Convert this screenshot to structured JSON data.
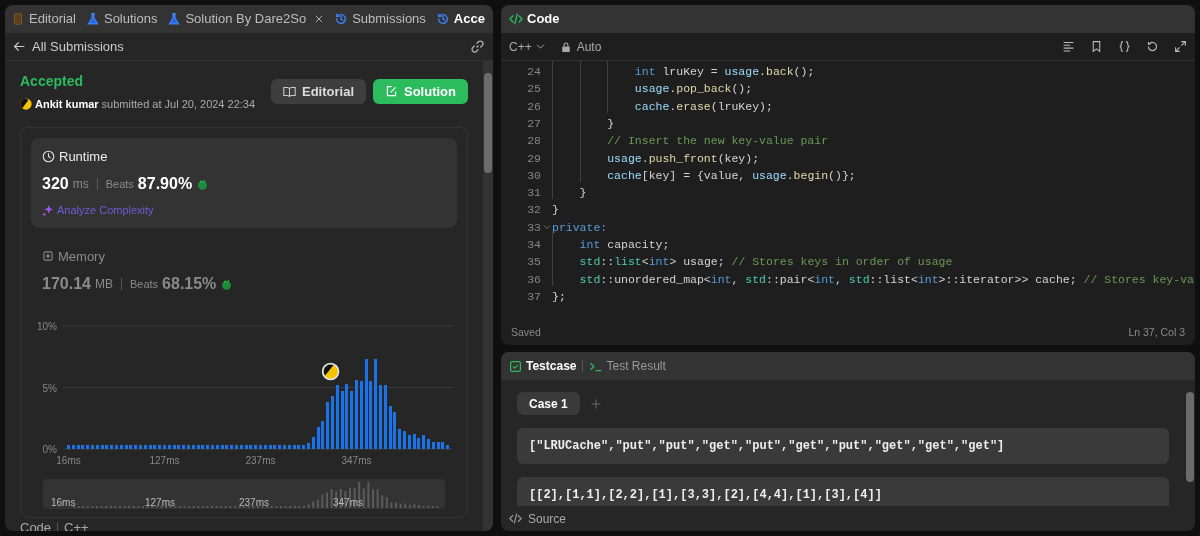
{
  "tabs": [
    {
      "label": "Editorial",
      "selected": false,
      "closable": false
    },
    {
      "label": "Solutions",
      "selected": false,
      "closable": false
    },
    {
      "label": "Solution By Dare2So",
      "selected": false,
      "closable": true
    },
    {
      "label": "Submissions",
      "selected": false,
      "closable": false
    },
    {
      "label": "Acce",
      "selected": true,
      "closable": false
    }
  ],
  "back_label": "All Submissions",
  "submission": {
    "status": "Accepted",
    "author": "Ankit kumar",
    "submitted": "submitted at Jul 20, 2024 22:34"
  },
  "buttons": [
    {
      "label": "Editorial",
      "kind": "secondary"
    },
    {
      "label": "Solution",
      "kind": "primary"
    }
  ],
  "metrics": [
    {
      "kind": "runtime",
      "title": "Runtime",
      "value": "320",
      "unit": "ms",
      "beats_label": "Beats",
      "beats": "87.90%",
      "analyze": "Analyze Complexity",
      "selected": true
    },
    {
      "kind": "memory",
      "title": "Memory",
      "value": "170.14",
      "unit": "MB",
      "beats_label": "Beats",
      "beats": "68.15%",
      "selected": false
    }
  ],
  "chart_data": {
    "type": "bar",
    "categories": [
      "16ms",
      null,
      null,
      null,
      null,
      null,
      null,
      null,
      null,
      null,
      null,
      null,
      null,
      null,
      null,
      null,
      null,
      null,
      null,
      null,
      "127ms",
      null,
      null,
      null,
      null,
      null,
      null,
      null,
      null,
      null,
      null,
      null,
      null,
      null,
      null,
      null,
      null,
      null,
      null,
      null,
      "237ms",
      null,
      null,
      null,
      null,
      null,
      null,
      null,
      null,
      null,
      null,
      null,
      null,
      null,
      null,
      null,
      null,
      null,
      null,
      null,
      "347ms",
      null,
      null,
      null,
      null,
      null,
      null,
      null,
      null,
      null,
      null,
      null,
      null,
      null,
      null,
      null,
      null,
      null,
      null,
      null
    ],
    "values": [
      0.3,
      0.3,
      0.3,
      0.3,
      0.3,
      0.3,
      0.3,
      0.3,
      0.3,
      0.3,
      0.3,
      0.3,
      0.3,
      0.3,
      0.3,
      0.3,
      0.3,
      0.3,
      0.3,
      0.3,
      0.3,
      0.3,
      0.3,
      0.3,
      0.3,
      0.3,
      0.3,
      0.3,
      0.3,
      0.3,
      0.3,
      0.3,
      0.3,
      0.3,
      0.3,
      0.3,
      0.3,
      0.3,
      0.3,
      0.3,
      0.3,
      0.3,
      0.3,
      0.3,
      0.3,
      0.3,
      0.3,
      0.3,
      0.3,
      0.3,
      0.5,
      1,
      1.8,
      2.3,
      3.8,
      4.3,
      5.2,
      4.7,
      5.3,
      4.7,
      5.6,
      5.5,
      7.3,
      5.5,
      7.3,
      5.2,
      5.2,
      3.5,
      3,
      1.6,
      1.5,
      1.1,
      1.2,
      0.9,
      1.1,
      0.8,
      0.6,
      0.6,
      0.6,
      0.3
    ],
    "ylim": [
      0,
      10
    ],
    "yticks": [
      {
        "value": 0,
        "label": "0%"
      },
      {
        "value": 5,
        "label": "5%"
      },
      {
        "value": 10,
        "label": "10%"
      }
    ]
  },
  "overview_labels": [
    "16ms",
    "127ms",
    "237ms",
    "347ms"
  ],
  "footer": {
    "label": "Code",
    "language": "C++"
  },
  "editor": {
    "title": "Code",
    "language": "C++",
    "mode": "Auto",
    "status": "Saved",
    "cursor": "Ln 37, Col 3",
    "lines": [
      {
        "number": "24",
        "fold": false,
        "tokens": [
          {
            "kind": "keyword",
            "text": "            int"
          },
          {
            "kind": "plain",
            "text": " lruKey = "
          },
          {
            "kind": "variable",
            "text": "usage"
          },
          {
            "kind": "plain",
            "text": "."
          },
          {
            "kind": "function",
            "text": "back"
          },
          {
            "kind": "plain",
            "text": "();"
          }
        ]
      },
      {
        "number": "25",
        "fold": false,
        "tokens": [
          {
            "kind": "variable",
            "text": "            usage"
          },
          {
            "kind": "plain",
            "text": "."
          },
          {
            "kind": "function",
            "text": "pop_back"
          },
          {
            "kind": "plain",
            "text": "();"
          }
        ]
      },
      {
        "number": "26",
        "fold": false,
        "tokens": [
          {
            "kind": "variable",
            "text": "            cache"
          },
          {
            "kind": "plain",
            "text": "."
          },
          {
            "kind": "function",
            "text": "erase"
          },
          {
            "kind": "plain",
            "text": "(lruKey);"
          }
        ]
      },
      {
        "number": "27",
        "fold": false,
        "tokens": [
          {
            "kind": "plain",
            "text": "        }"
          }
        ]
      },
      {
        "number": "28",
        "fold": false,
        "tokens": [
          {
            "kind": "comment",
            "text": "        // Insert the new key-value pair"
          }
        ]
      },
      {
        "number": "29",
        "fold": false,
        "tokens": [
          {
            "kind": "variable",
            "text": "        usage"
          },
          {
            "kind": "plain",
            "text": "."
          },
          {
            "kind": "function",
            "text": "push_front"
          },
          {
            "kind": "plain",
            "text": "(key);"
          }
        ]
      },
      {
        "number": "30",
        "fold": false,
        "tokens": [
          {
            "kind": "variable",
            "text": "        cache"
          },
          {
            "kind": "plain",
            "text": "[key] = {value, "
          },
          {
            "kind": "variable",
            "text": "usage"
          },
          {
            "kind": "plain",
            "text": "."
          },
          {
            "kind": "function",
            "text": "begin"
          },
          {
            "kind": "plain",
            "text": "()};"
          }
        ]
      },
      {
        "number": "31",
        "fold": false,
        "tokens": [
          {
            "kind": "plain",
            "text": "    }"
          }
        ]
      },
      {
        "number": "32",
        "fold": false,
        "tokens": [
          {
            "kind": "plain",
            "text": "}"
          }
        ]
      },
      {
        "number": "33",
        "fold": true,
        "tokens": [
          {
            "kind": "keyword",
            "text": "private:"
          }
        ]
      },
      {
        "number": "34",
        "fold": false,
        "tokens": [
          {
            "kind": "keyword",
            "text": "    int"
          },
          {
            "kind": "plain",
            "text": " capacity;"
          }
        ]
      },
      {
        "number": "35",
        "fold": false,
        "tokens": [
          {
            "kind": "type",
            "text": "    std"
          },
          {
            "kind": "plain",
            "text": "::"
          },
          {
            "kind": "type",
            "text": "list"
          },
          {
            "kind": "plain",
            "text": "<"
          },
          {
            "kind": "keyword",
            "text": "int"
          },
          {
            "kind": "plain",
            "text": "> usage; "
          },
          {
            "kind": "comment",
            "text": "// Stores keys in order of usage"
          }
        ]
      },
      {
        "number": "36",
        "fold": false,
        "tokens": [
          {
            "kind": "type",
            "text": "    std"
          },
          {
            "kind": "plain",
            "text": "::unordered_map<"
          },
          {
            "kind": "keyword",
            "text": "int"
          },
          {
            "kind": "plain",
            "text": ", "
          },
          {
            "kind": "type",
            "text": "std"
          },
          {
            "kind": "plain",
            "text": "::pair<"
          },
          {
            "kind": "keyword",
            "text": "int"
          },
          {
            "kind": "plain",
            "text": ", "
          },
          {
            "kind": "type",
            "text": "std"
          },
          {
            "kind": "plain",
            "text": "::list<"
          },
          {
            "kind": "keyword",
            "text": "int"
          },
          {
            "kind": "plain",
            "text": ">::iterator>> cache; "
          },
          {
            "kind": "comment",
            "text": "// Stores key-va"
          }
        ]
      },
      {
        "number": "37",
        "fold": false,
        "tokens": [
          {
            "kind": "plain",
            "text": "};"
          }
        ]
      }
    ]
  },
  "testcase": {
    "tabs": [
      {
        "label": "Testcase",
        "selected": true
      },
      {
        "label": "Test Result",
        "selected": false
      }
    ],
    "cases": [
      {
        "label": "Case 1",
        "selected": true
      }
    ],
    "inputs": [
      "[\"LRUCache\",\"put\",\"put\",\"get\",\"put\",\"get\",\"put\",\"get\",\"get\",\"get\"]",
      "[[2],[1,1],[2,2],[1],[3,3],[2],[4,4],[1],[3],[4]]"
    ],
    "footer": "Source"
  }
}
